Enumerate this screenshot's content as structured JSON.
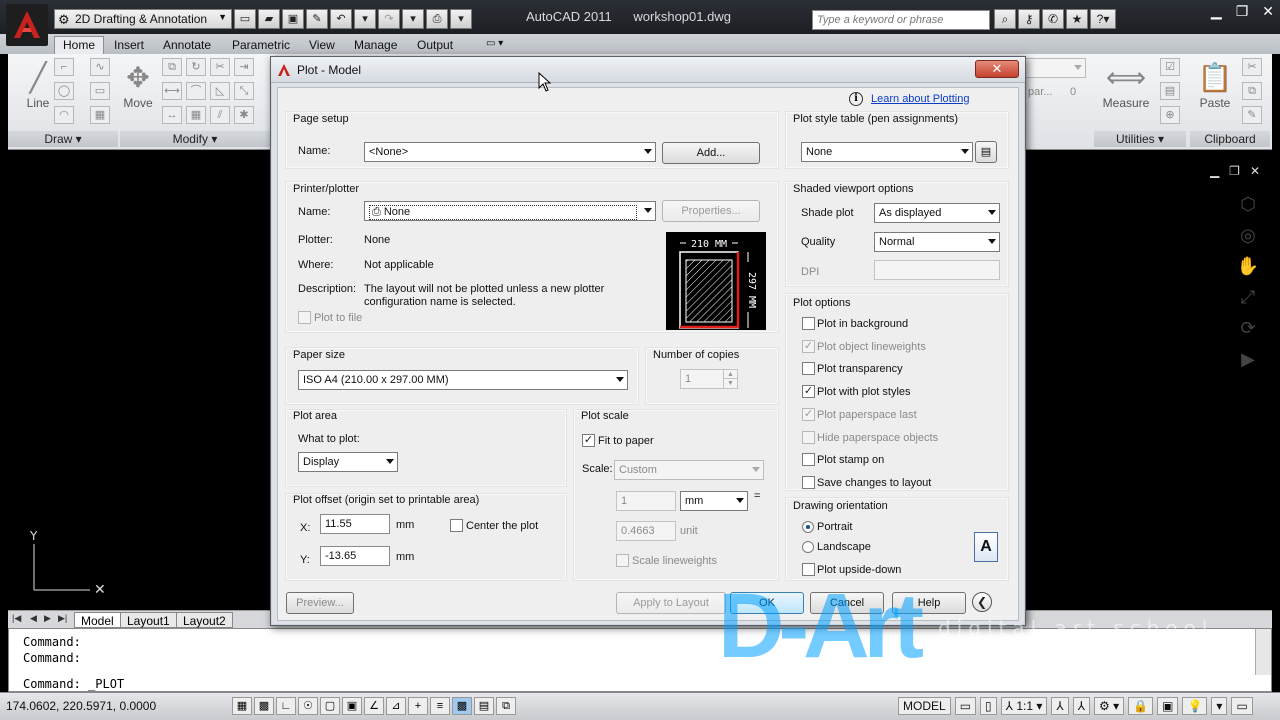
{
  "app": {
    "workspace": "2D Drafting & Annotation",
    "title": "AutoCAD 2011",
    "filename": "workshop01.dwg",
    "search_placeholder": "Type a keyword or phrase"
  },
  "ribbon": {
    "tabs": [
      "Home",
      "Insert",
      "Annotate",
      "Parametric",
      "View",
      "Manage",
      "Output"
    ],
    "panels": {
      "draw": "Draw",
      "modify": "Modify",
      "utilities": "Utilities",
      "clipboard": "Clipboard"
    },
    "buttons": {
      "line": "Line",
      "move": "Move",
      "measure": "Measure",
      "paste": "Paste"
    }
  },
  "layout_tabs": [
    "Model",
    "Layout1",
    "Layout2"
  ],
  "command": {
    "lines": [
      "Command:",
      "Command:"
    ],
    "prompt": "Command:  _PLOT"
  },
  "status": {
    "coords": "174.0602, 220.5971, 0.0000",
    "model": "MODEL",
    "scale": "1:1"
  },
  "watermark": {
    "logo": "D-Art",
    "text": "digital art school"
  },
  "dialog": {
    "title": "Plot - Model",
    "learn_link": "Learn about Plotting",
    "page_setup": {
      "title": "Page setup",
      "name_label": "Name:",
      "name_value": "<None>",
      "add_button": "Add..."
    },
    "printer": {
      "title": "Printer/plotter",
      "name_label": "Name:",
      "name_value": "None",
      "properties_button": "Properties...",
      "plotter_label": "Plotter:",
      "plotter_value": "None",
      "where_label": "Where:",
      "where_value": "Not applicable",
      "description_label": "Description:",
      "description_value": "The layout will not be plotted unless a new plotter configuration name is selected.",
      "plot_to_file": "Plot to file",
      "preview_width": "210 MM",
      "preview_height": "297 MM"
    },
    "paper_size": {
      "title": "Paper size",
      "value": "ISO A4 (210.00 x 297.00 MM)"
    },
    "copies": {
      "title": "Number of copies",
      "value": "1"
    },
    "plot_area": {
      "title": "Plot area",
      "what_label": "What to plot:",
      "what_value": "Display"
    },
    "plot_scale": {
      "title": "Plot scale",
      "fit_to_paper": "Fit to paper",
      "scale_label": "Scale:",
      "scale_value": "Custom",
      "value1": "1",
      "unit1": "mm",
      "equals": "=",
      "value2": "0.4663",
      "unit2": "unit",
      "scale_lineweights": "Scale lineweights"
    },
    "plot_offset": {
      "title": "Plot offset (origin set to printable area)",
      "x_label": "X:",
      "x_value": "11.55",
      "y_label": "Y:",
      "y_value": "-13.65",
      "unit": "mm",
      "center_plot": "Center the plot"
    },
    "plot_style_table": {
      "title": "Plot style table (pen assignments)",
      "value": "None"
    },
    "shaded": {
      "title": "Shaded viewport options",
      "shade_label": "Shade plot",
      "shade_value": "As displayed",
      "quality_label": "Quality",
      "quality_value": "Normal",
      "dpi_label": "DPI"
    },
    "plot_options": {
      "title": "Plot options",
      "items": [
        {
          "label": "Plot in background",
          "checked": false,
          "disabled": false
        },
        {
          "label": "Plot object lineweights",
          "checked": true,
          "disabled": true
        },
        {
          "label": "Plot transparency",
          "checked": false,
          "disabled": false
        },
        {
          "label": "Plot with plot styles",
          "checked": true,
          "disabled": false
        },
        {
          "label": "Plot paperspace last",
          "checked": true,
          "disabled": true
        },
        {
          "label": "Hide paperspace objects",
          "checked": false,
          "disabled": true
        },
        {
          "label": "Plot stamp on",
          "checked": false,
          "disabled": false
        },
        {
          "label": "Save changes to layout",
          "checked": false,
          "disabled": false
        }
      ]
    },
    "orientation": {
      "title": "Drawing orientation",
      "portrait": "Portrait",
      "landscape": "Landscape",
      "upside_down": "Plot upside-down",
      "icon_letter": "A"
    },
    "buttons": {
      "preview": "Preview...",
      "apply": "Apply to Layout",
      "ok": "OK",
      "cancel": "Cancel",
      "help": "Help"
    }
  }
}
